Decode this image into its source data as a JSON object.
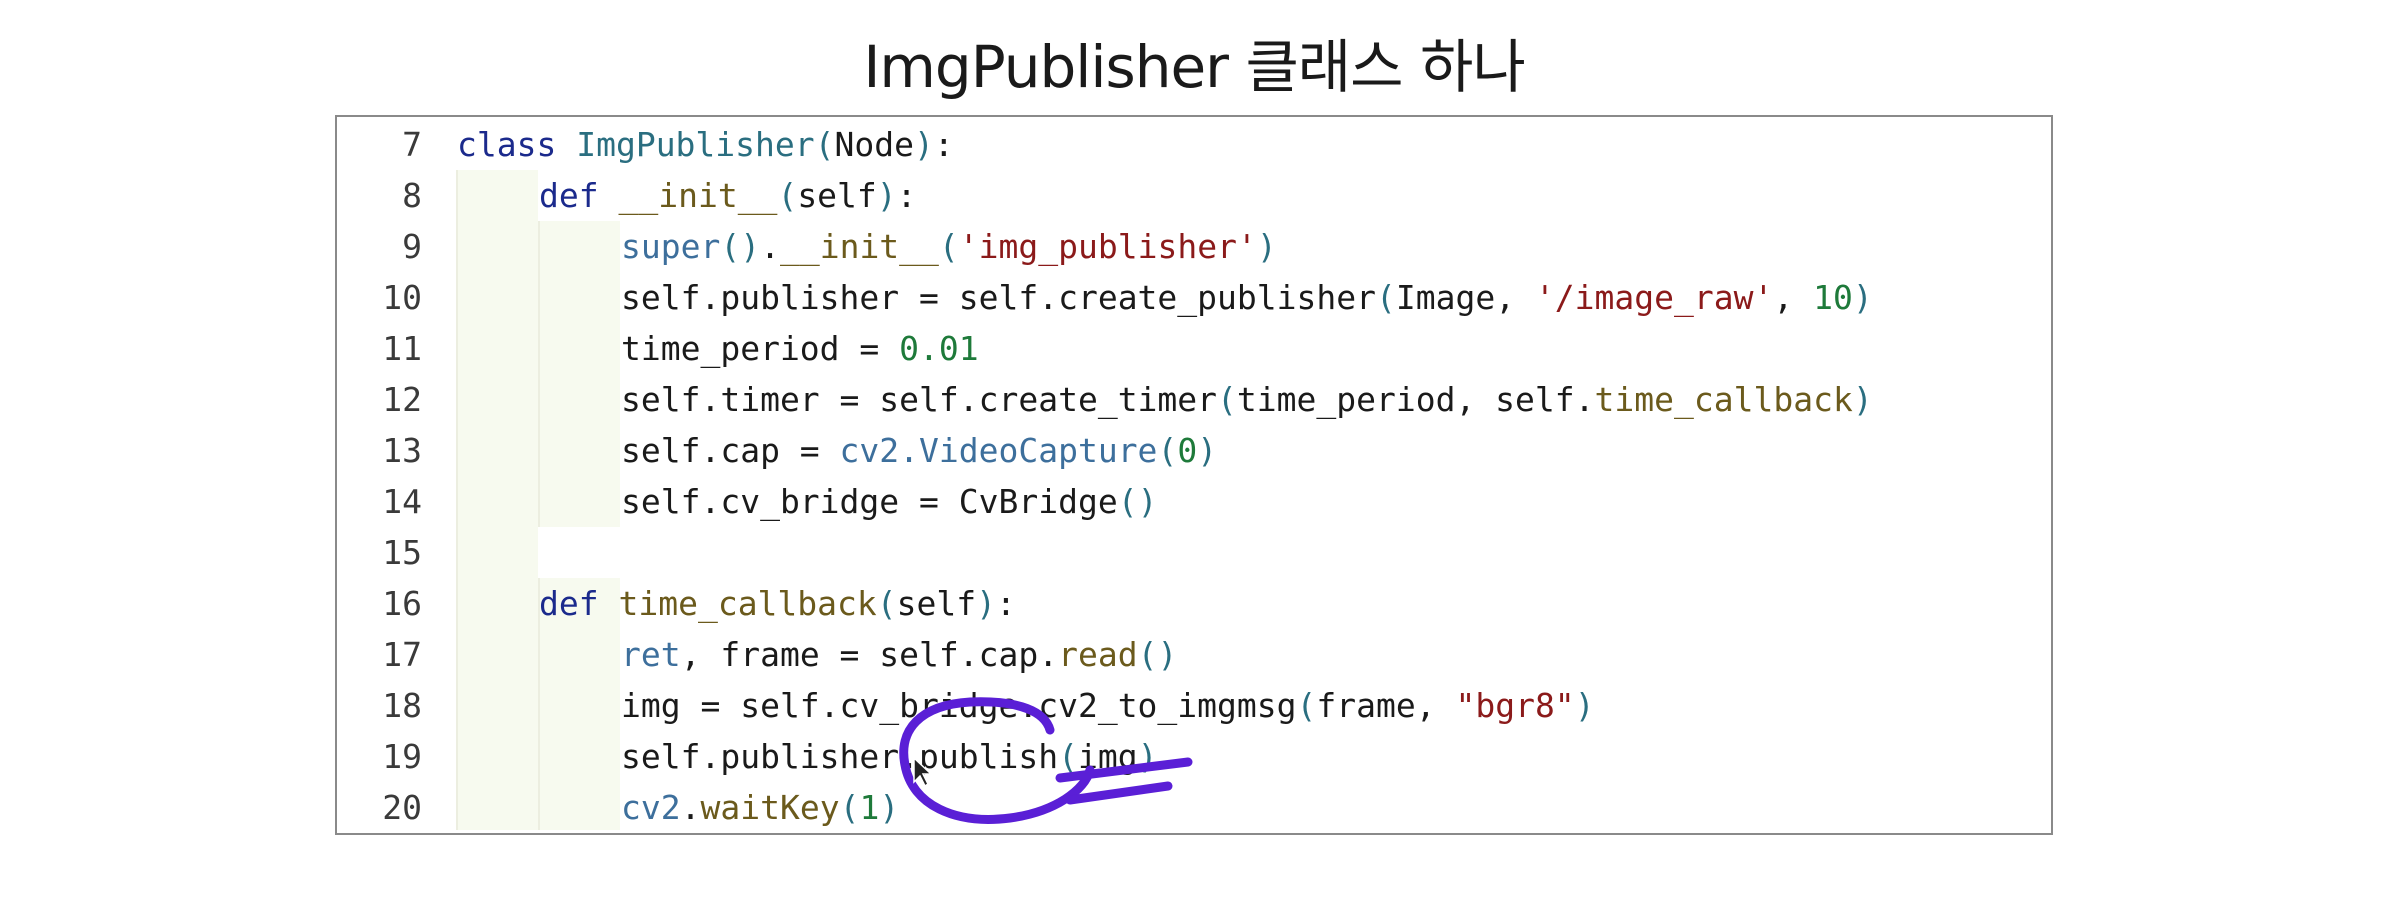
{
  "slide": {
    "title": "ImgPublisher 클래스 하나"
  },
  "code": {
    "lines": [
      {
        "num": "7",
        "indent": 0,
        "tokens": [
          [
            "kw",
            "class "
          ],
          [
            "cls",
            "ImgPublisher"
          ],
          [
            "par",
            "("
          ],
          [
            "plain",
            "Node"
          ],
          [
            "par",
            ")"
          ],
          [
            "plain",
            ":"
          ]
        ]
      },
      {
        "num": "8",
        "indent": 1,
        "tokens": [
          [
            "kw",
            "def "
          ],
          [
            "fn",
            "__init__"
          ],
          [
            "par",
            "("
          ],
          [
            "plain",
            "self"
          ],
          [
            "par",
            ")"
          ],
          [
            "plain",
            ":"
          ]
        ]
      },
      {
        "num": "9",
        "indent": 2,
        "tokens": [
          [
            "bi",
            "super"
          ],
          [
            "par",
            "()"
          ],
          [
            "plain",
            "."
          ],
          [
            "fn",
            "__init__"
          ],
          [
            "par",
            "("
          ],
          [
            "str",
            "'img_publisher'"
          ],
          [
            "par",
            ")"
          ]
        ]
      },
      {
        "num": "10",
        "indent": 2,
        "tokens": [
          [
            "plain",
            "self.publisher = self.create_publisher"
          ],
          [
            "par",
            "("
          ],
          [
            "plain",
            "Image, "
          ],
          [
            "str",
            "'/image_raw'"
          ],
          [
            "plain",
            ", "
          ],
          [
            "num",
            "10"
          ],
          [
            "par",
            ")"
          ]
        ]
      },
      {
        "num": "11",
        "indent": 2,
        "tokens": [
          [
            "plain",
            "time_period = "
          ],
          [
            "num",
            "0.01"
          ]
        ]
      },
      {
        "num": "12",
        "indent": 2,
        "tokens": [
          [
            "plain",
            "self.timer = self.create_timer"
          ],
          [
            "par",
            "("
          ],
          [
            "plain",
            "time_period, self."
          ],
          [
            "fn",
            "time_callback"
          ],
          [
            "par",
            ")"
          ]
        ]
      },
      {
        "num": "13",
        "indent": 2,
        "tokens": [
          [
            "plain",
            "self.cap = "
          ],
          [
            "bi",
            "cv2.VideoCapture"
          ],
          [
            "par",
            "("
          ],
          [
            "num",
            "0"
          ],
          [
            "par",
            ")"
          ]
        ]
      },
      {
        "num": "14",
        "indent": 2,
        "tokens": [
          [
            "plain",
            "self.cv_bridge = CvBridge"
          ],
          [
            "par",
            "()"
          ]
        ]
      },
      {
        "num": "15",
        "indent": 0,
        "tokens": []
      },
      {
        "num": "16",
        "indent": 1,
        "tokens": [
          [
            "kw",
            "def "
          ],
          [
            "fn",
            "time_callback"
          ],
          [
            "par",
            "("
          ],
          [
            "plain",
            "self"
          ],
          [
            "par",
            ")"
          ],
          [
            "plain",
            ":"
          ]
        ]
      },
      {
        "num": "17",
        "indent": 2,
        "tokens": [
          [
            "bi",
            "ret"
          ],
          [
            "plain",
            ", frame = self.cap."
          ],
          [
            "fn",
            "read"
          ],
          [
            "par",
            "()"
          ]
        ]
      },
      {
        "num": "18",
        "indent": 2,
        "tokens": [
          [
            "plain",
            "img = self.cv_bridge.cv2_to_imgmsg"
          ],
          [
            "par",
            "("
          ],
          [
            "plain",
            "frame, "
          ],
          [
            "str",
            "\"bgr8\""
          ],
          [
            "par",
            ")"
          ]
        ]
      },
      {
        "num": "19",
        "indent": 2,
        "tokens": [
          [
            "plain",
            "self.publisher.publish"
          ],
          [
            "par",
            "("
          ],
          [
            "plain",
            "img"
          ],
          [
            "par",
            ")"
          ]
        ]
      },
      {
        "num": "20",
        "indent": 2,
        "tokens": [
          [
            "bi",
            "cv2"
          ],
          [
            "plain",
            "."
          ],
          [
            "fn",
            "waitKey"
          ],
          [
            "par",
            "("
          ],
          [
            "num",
            "1"
          ],
          [
            "par",
            ")"
          ]
        ]
      }
    ]
  },
  "colors": {
    "annotation_ink": "#5a1fd6"
  }
}
